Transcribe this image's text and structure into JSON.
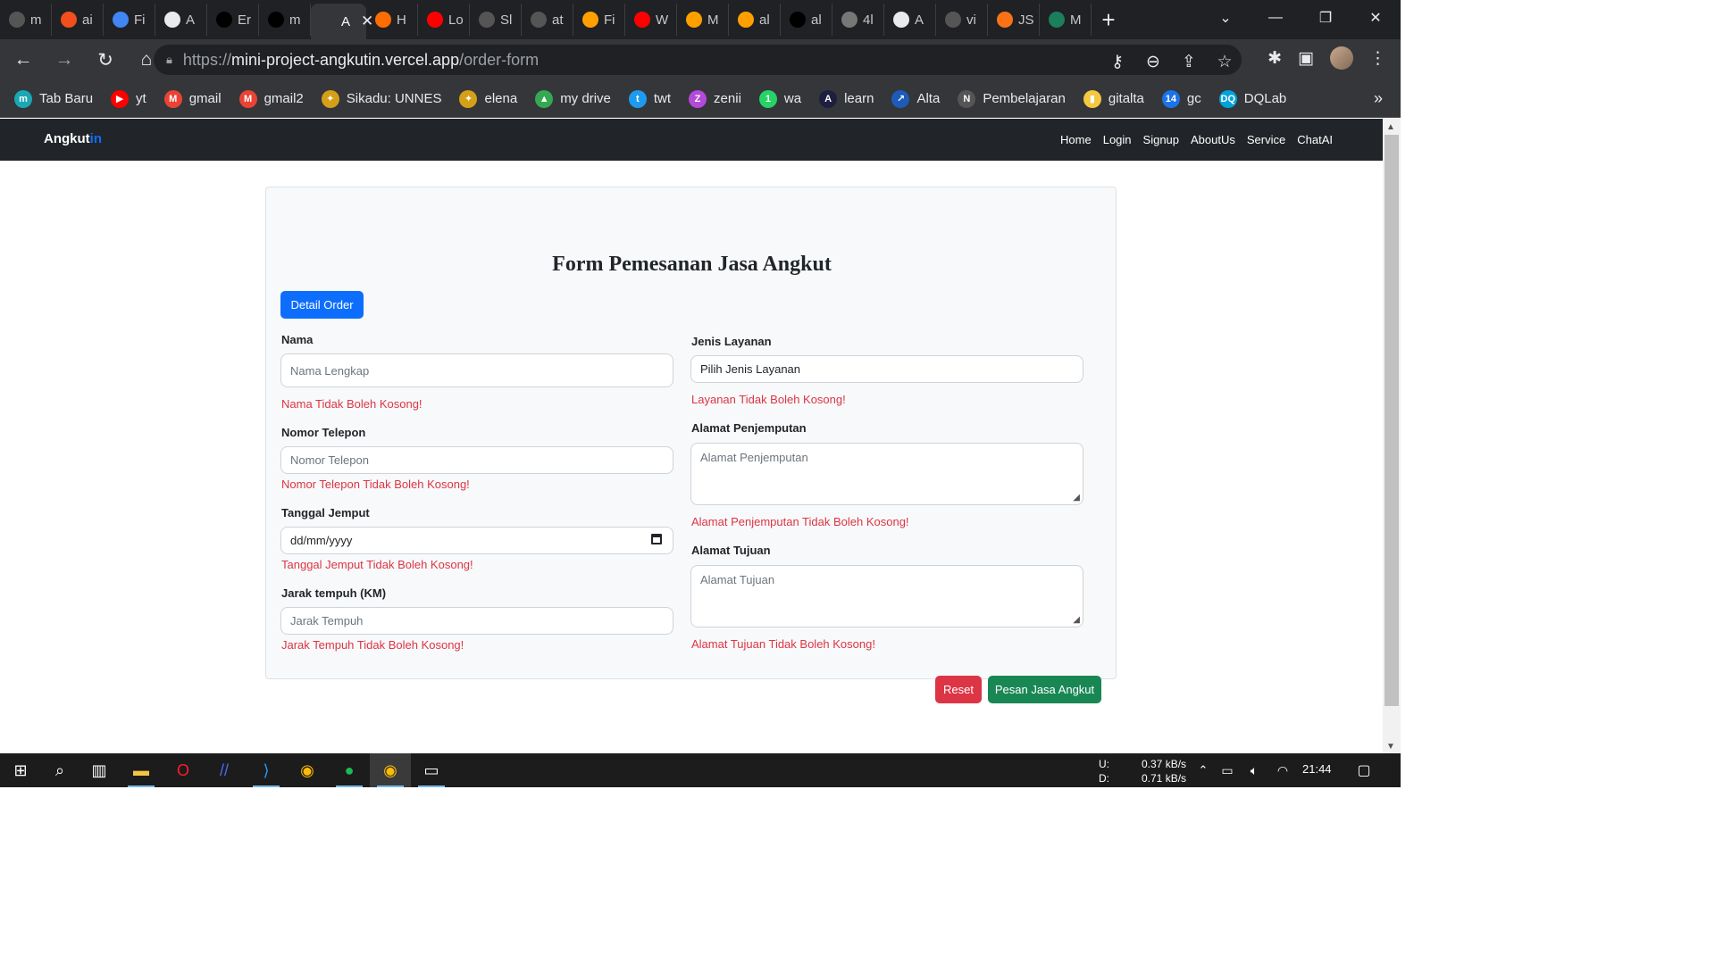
{
  "tabs": [
    {
      "label": "m",
      "icon": "github-icon"
    },
    {
      "label": "ai",
      "icon": "figma-icon"
    },
    {
      "label": "Fi",
      "icon": "docs-icon"
    },
    {
      "label": "A",
      "icon": "site-icon"
    },
    {
      "label": "Er",
      "icon": "vercel-icon"
    },
    {
      "label": "m",
      "icon": "vercel-icon"
    },
    {
      "label": "A",
      "icon": "active-tab-icon",
      "active": true
    },
    {
      "label": "H",
      "icon": "u-icon"
    },
    {
      "label": "Lo",
      "icon": "youtube-icon"
    },
    {
      "label": "Sl",
      "icon": "github-icon"
    },
    {
      "label": "at",
      "icon": "github-icon"
    },
    {
      "label": "Fi",
      "icon": "firebase-icon"
    },
    {
      "label": "W",
      "icon": "youtube-icon"
    },
    {
      "label": "M",
      "icon": "firebase-icon"
    },
    {
      "label": "al",
      "icon": "firebase-icon"
    },
    {
      "label": "al",
      "icon": "vercel-icon"
    },
    {
      "label": "4l",
      "icon": "globe-icon"
    },
    {
      "label": "A",
      "icon": "site-icon"
    },
    {
      "label": "vi",
      "icon": "github-icon"
    },
    {
      "label": "JS",
      "icon": "js-icon"
    },
    {
      "label": "M",
      "icon": "mt-icon"
    }
  ],
  "address": {
    "proto": "https://",
    "host": "mini-project-angkutin.vercel.app",
    "path": "/order-form"
  },
  "bookmarks": [
    {
      "label": "Tab Baru",
      "color": "#1aa8b4",
      "glyph": "m"
    },
    {
      "label": "yt",
      "color": "#ff0000",
      "glyph": "▶"
    },
    {
      "label": "gmail",
      "color": "#ea4335",
      "glyph": "M"
    },
    {
      "label": "gmail2",
      "color": "#ea4335",
      "glyph": "M"
    },
    {
      "label": "Sikadu: UNNES",
      "color": "#d4a017",
      "glyph": "✦"
    },
    {
      "label": "elena",
      "color": "#d4a017",
      "glyph": "✦"
    },
    {
      "label": "my drive",
      "color": "#34a853",
      "glyph": "▲"
    },
    {
      "label": "twt",
      "color": "#1d9bf0",
      "glyph": "t"
    },
    {
      "label": "zenii",
      "color": "#b44ad9",
      "glyph": "Z"
    },
    {
      "label": "wa",
      "color": "#25d366",
      "glyph": "1"
    },
    {
      "label": "learn",
      "color": "#1e1e3f",
      "glyph": "A"
    },
    {
      "label": "Alta",
      "color": "#1e5bb8",
      "glyph": "↗"
    },
    {
      "label": "Pembelajaran",
      "color": "#555555",
      "glyph": "N"
    },
    {
      "label": "gitalta",
      "color": "#f5c842",
      "glyph": "▮"
    },
    {
      "label": "gc",
      "color": "#1a73e8",
      "glyph": "14"
    },
    {
      "label": "DQLab",
      "color": "#00a3d9",
      "glyph": "DQ"
    }
  ],
  "app": {
    "brand_main": "Angkut",
    "brand_accent": "in",
    "nav": [
      "Home",
      "Login",
      "Signup",
      "AboutUs",
      "Service",
      "ChatAI"
    ]
  },
  "form": {
    "title": "Form Pemesanan Jasa Angkut",
    "detail_button": "Detail Order",
    "nama": {
      "label": "Nama",
      "placeholder": "Nama Lengkap",
      "error": "Nama Tidak Boleh Kosong!"
    },
    "telepon": {
      "label": "Nomor Telepon",
      "placeholder": "Nomor Telepon",
      "error": "Nomor Telepon Tidak Boleh Kosong!"
    },
    "tanggal": {
      "label": "Tanggal Jemput",
      "placeholder": "dd/mm/yyyy",
      "error": "Tanggal Jemput Tidak Boleh Kosong!"
    },
    "jarak": {
      "label": "Jarak tempuh (KM)",
      "placeholder": "Jarak Tempuh",
      "error": "Jarak Tempuh Tidak Boleh Kosong!"
    },
    "layanan": {
      "label": "Jenis Layanan",
      "value": "Pilih Jenis Layanan",
      "error": "Layanan Tidak Boleh Kosong!"
    },
    "jemput": {
      "label": "Alamat Penjemputan",
      "placeholder": "Alamat Penjemputan",
      "error": "Alamat Penjemputan Tidak Boleh Kosong!"
    },
    "tujuan": {
      "label": "Alamat Tujuan",
      "placeholder": "Alamat Tujuan",
      "error": "Alamat Tujuan Tidak Boleh Kosong!"
    },
    "reset_button": "Reset",
    "submit_button": "Pesan Jasa Angkut"
  },
  "taskbar": {
    "upload_label": "U:",
    "download_label": "D:",
    "upload_rate": "0.37 kB/s",
    "download_rate": "0.71 kB/s",
    "time": "21:44"
  }
}
